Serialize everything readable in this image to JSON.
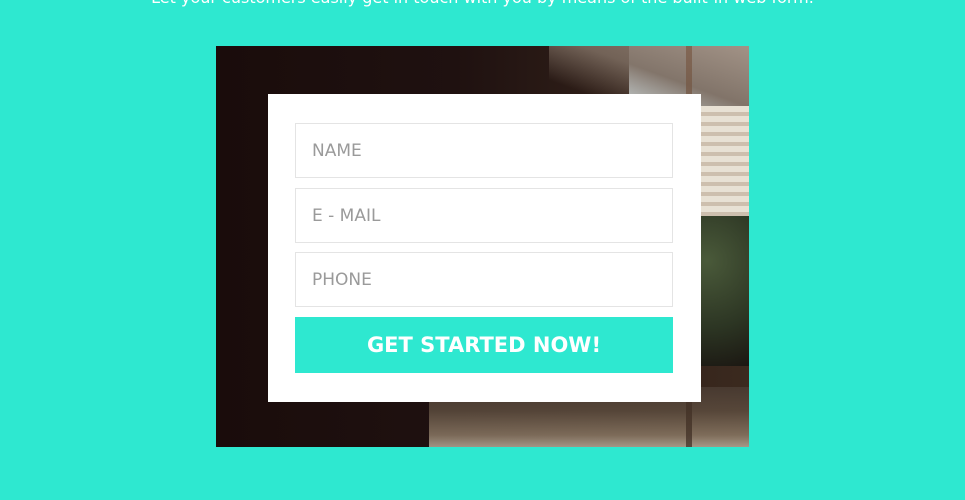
{
  "header": {
    "tagline": "Let your customers easily get in touch with you by means of the built-in web form."
  },
  "form": {
    "name_placeholder": "NAME",
    "email_placeholder": "E - MAIL",
    "phone_placeholder": "PHONE",
    "submit_label": "GET STARTED NOW!"
  },
  "colors": {
    "background": "#2ee8d0",
    "button": "#2ee8d0",
    "card": "#ffffff"
  }
}
